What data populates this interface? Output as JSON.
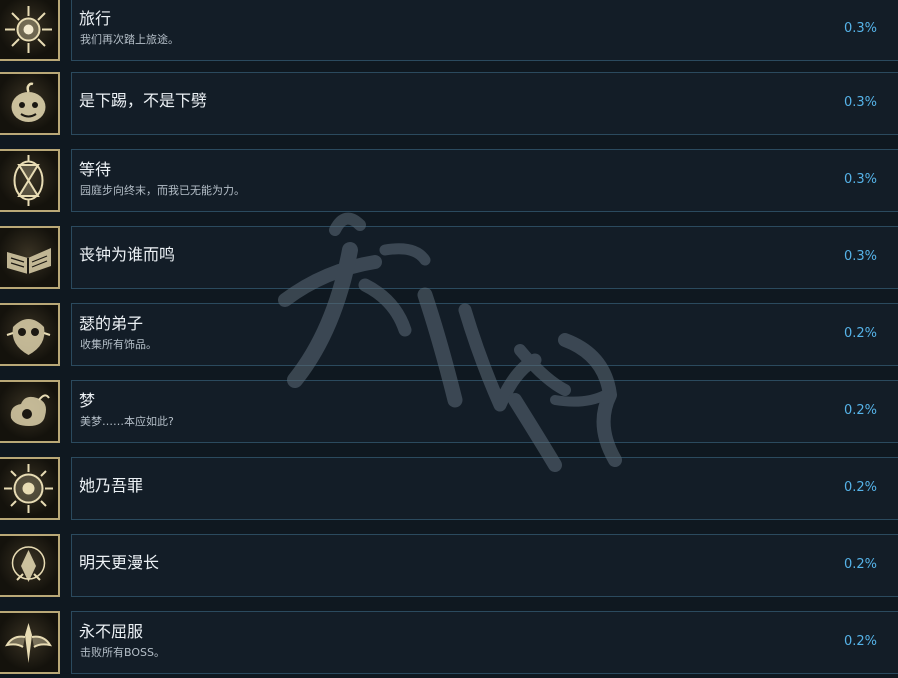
{
  "achievements": [
    {
      "title": "旅行",
      "desc": "我们再次踏上旅途。",
      "percent": "0.3%",
      "icon": "burst-emblem-icon"
    },
    {
      "title": "是下踢，不是下劈",
      "desc": "",
      "percent": "0.3%",
      "icon": "pumpkin-icon"
    },
    {
      "title": "等待",
      "desc": "园庭步向终末，而我已无能为力。",
      "percent": "0.3%",
      "icon": "hourglass-icon"
    },
    {
      "title": "丧钟为谁而鸣",
      "desc": "",
      "percent": "0.3%",
      "icon": "open-book-icon"
    },
    {
      "title": "瑟的弟子",
      "desc": "收集所有饰品。",
      "percent": "0.2%",
      "icon": "mask-icon"
    },
    {
      "title": "梦",
      "desc": "美梦……本应如此?",
      "percent": "0.2%",
      "icon": "cloud-eye-icon"
    },
    {
      "title": "她乃吾罪",
      "desc": "",
      "percent": "0.2%",
      "icon": "sun-eye-icon"
    },
    {
      "title": "明天更漫长",
      "desc": "",
      "percent": "0.2%",
      "icon": "crystal-flame-icon"
    },
    {
      "title": "永不屈服",
      "desc": "击败所有BOSS。",
      "percent": "0.2%",
      "icon": "winged-crest-icon"
    }
  ],
  "colors": {
    "background": "#0f1820",
    "card": "#131d27",
    "card_border": "#2b4a5e",
    "percent": "#56b3e8",
    "icon_gold": "#e8dcb4"
  }
}
